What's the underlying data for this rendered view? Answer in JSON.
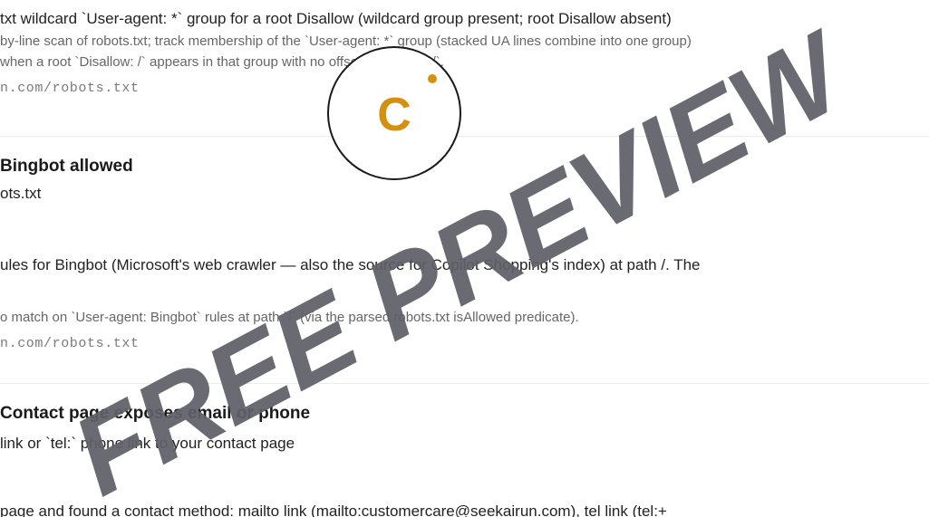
{
  "checks": [
    {
      "title": "txt wildcard `User-agent: *` group for a root Disallow (wildcard group present; root Disallow absent)",
      "detail_lines": [
        "by-line scan of robots.txt; track membership of the `User-agent: *` group (stacked UA lines combine into one group)",
        "when a root `Disallow: /` appears in that group with no offsetting `Allow: /`."
      ],
      "source": "n.com/robots.txt"
    },
    {
      "title": "Bingbot allowed",
      "subtitle": "ots.txt",
      "description": "ules for Bingbot (Microsoft's web crawler — also the source for Copilot Shopping's index) at path /. The",
      "detail": "o match on `User-agent: Bingbot` rules at path `/` (via the parsed robots.txt isAllowed predicate).",
      "source": "n.com/robots.txt"
    },
    {
      "title": "Contact page exposes email or phone",
      "subtitle": "link or `tel:` phone link to your contact page",
      "description": "page and found a contact method: mailto link (mailto:customercare@seekairun.com), tel link (tel:+"
    }
  ],
  "badge": {
    "letter": "C",
    "accent_color": "#d4900f"
  },
  "watermark": {
    "text": "FREE PREVIEW",
    "color": "#5f6068"
  }
}
